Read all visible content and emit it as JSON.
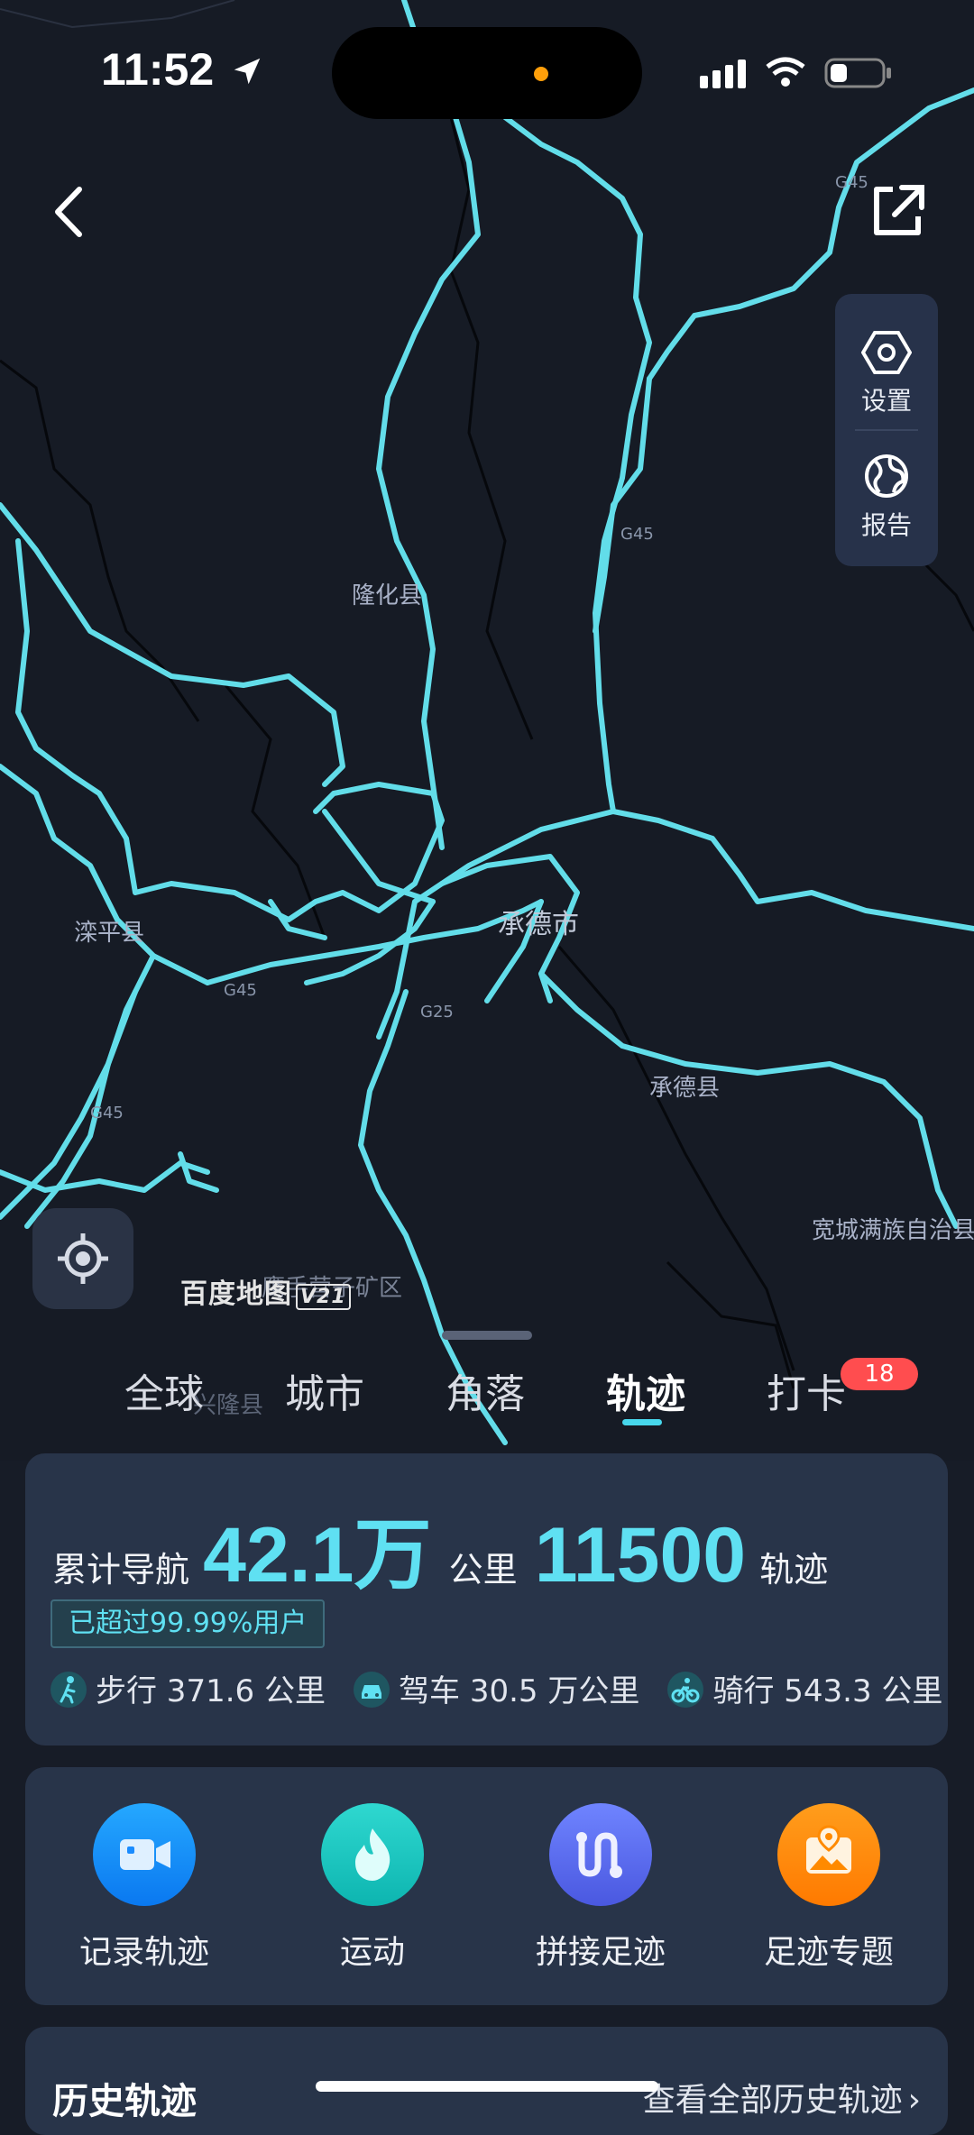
{
  "status_bar": {
    "time": "11:52"
  },
  "side_menu": {
    "settings_label": "设置",
    "report_label": "报告"
  },
  "map": {
    "labels": {
      "longhua": "隆化县",
      "luanping": "滦平县",
      "chengde_city": "承德市",
      "chengde_county": "承德县",
      "kuancheng": "宽城满族自治县",
      "yingzi": "鹰手营子矿区",
      "xinglong": "兴隆县"
    },
    "shields": {
      "g45_a": "G45",
      "g45_b": "G45",
      "g45_c": "G45",
      "g45_d": "G45",
      "g25": "G25"
    },
    "logo_text": "百度地图",
    "logo_version": "V21",
    "track_color": "#67e8f4"
  },
  "tabs": [
    {
      "label": "全球"
    },
    {
      "label": "城市"
    },
    {
      "label": "角落"
    },
    {
      "label": "轨迹"
    },
    {
      "label": "打卡"
    }
  ],
  "active_tab": "轨迹",
  "checkin_badge": "18",
  "summary": {
    "prefix": "累计导航",
    "distance_value": "42.1万",
    "distance_unit": "公里",
    "tracks_value": "11500",
    "tracks_unit": "轨迹",
    "percentile": "已超过99.99%用户",
    "walk": "步行 371.6 公里",
    "drive": "驾车 30.5 万公里",
    "ride": "骑行 543.3 公里"
  },
  "features": [
    {
      "label": "记录轨迹",
      "color": "#1a8cff"
    },
    {
      "label": "运动",
      "color": "#13c2c2"
    },
    {
      "label": "拼接足迹",
      "color": "#5a6cf0"
    },
    {
      "label": "足迹专题",
      "color": "#ff8a00"
    }
  ],
  "history": {
    "title": "历史轨迹",
    "view_all": "查看全部历史轨迹"
  }
}
